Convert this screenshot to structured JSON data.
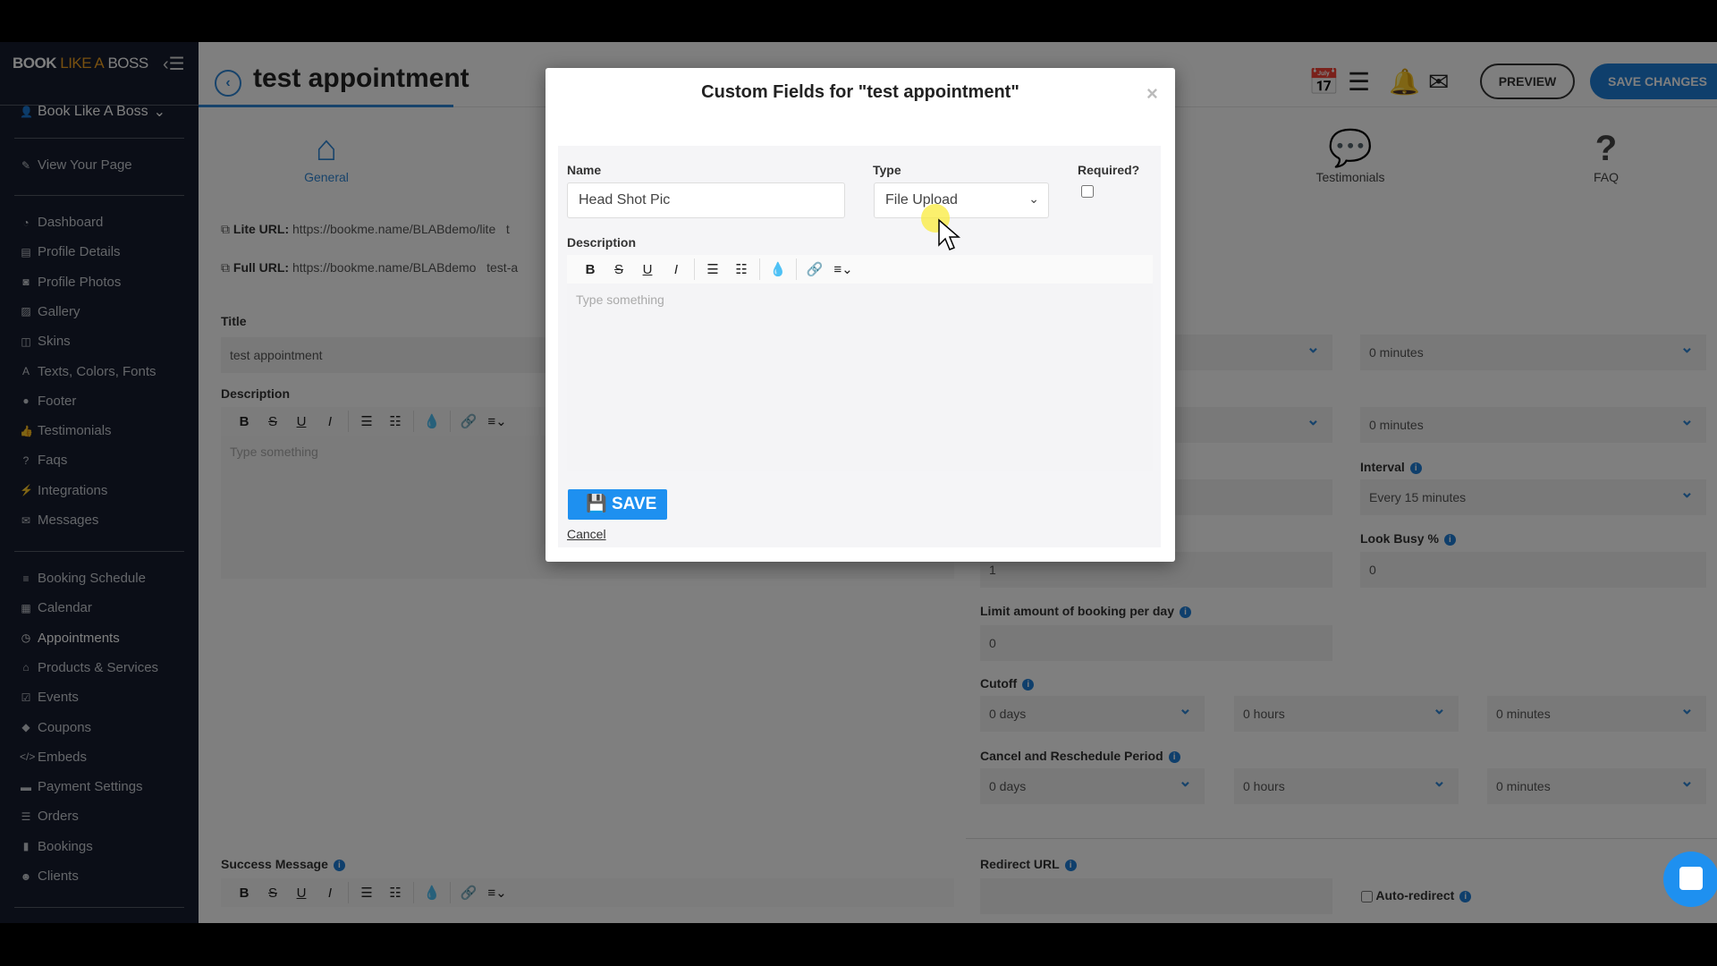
{
  "sidebar": {
    "logo": {
      "part1": "BOOK",
      "part2": "LIKE A",
      "part3": "BOSS"
    },
    "user": "Book Like A Boss",
    "view_page": "View Your Page",
    "items_a": [
      {
        "label": "Dashboard",
        "icon": "dashboard-icon"
      },
      {
        "label": "Profile Details",
        "icon": "id-card-icon"
      },
      {
        "label": "Profile Photos",
        "icon": "camera-icon"
      },
      {
        "label": "Gallery",
        "icon": "image-icon"
      },
      {
        "label": "Skins",
        "icon": "columns-icon"
      },
      {
        "label": "Texts, Colors, Fonts",
        "icon": "font-icon"
      },
      {
        "label": "Footer",
        "icon": "tint-icon"
      },
      {
        "label": "Testimonials",
        "icon": "thumbs-up-icon"
      },
      {
        "label": "Faqs",
        "icon": "question-icon"
      },
      {
        "label": "Integrations",
        "icon": "plug-icon"
      },
      {
        "label": "Messages",
        "icon": "envelope-icon"
      }
    ],
    "items_b": [
      {
        "label": "Booking Schedule",
        "icon": "sliders-icon"
      },
      {
        "label": "Calendar",
        "icon": "calendar-icon"
      },
      {
        "label": "Appointments",
        "icon": "clock-icon",
        "active": true
      },
      {
        "label": "Products & Services",
        "icon": "basket-icon"
      },
      {
        "label": "Events",
        "icon": "calendar-check-icon"
      },
      {
        "label": "Coupons",
        "icon": "tags-icon"
      },
      {
        "label": "Embeds",
        "icon": "code-icon"
      },
      {
        "label": "Payment Settings",
        "icon": "money-icon"
      },
      {
        "label": "Orders",
        "icon": "list-icon"
      },
      {
        "label": "Bookings",
        "icon": "clipboard-icon"
      },
      {
        "label": "Clients",
        "icon": "users-icon"
      }
    ]
  },
  "header": {
    "title": "test appointment",
    "preview": "PREVIEW",
    "save_changes": "SAVE CHANGES"
  },
  "tabs": [
    {
      "label": "General",
      "icon": "home-icon",
      "active": true
    },
    {
      "label": "Testimonials",
      "icon": "comments-icon"
    },
    {
      "label": "FAQ",
      "icon": "question-icon"
    }
  ],
  "urls": {
    "lite_label": "Lite URL:",
    "lite": "https://bookme.name/BLABdemo/lite",
    "lite_extra": "t",
    "full_label": "Full URL:",
    "full": "https://bookme.name/BLABdemo",
    "full_extra": "test-a"
  },
  "form": {
    "title_label": "Title",
    "title_value": "test appointment",
    "description_label": "Description",
    "editor_placeholder": "Type something",
    "success_label": "Success Message",
    "row1_b": "0 minutes",
    "row2_b": "0 minutes",
    "interval_label": "Interval",
    "interval_value": "Every 15 minutes",
    "look_busy_label": "Look Busy %",
    "look_busy_value": "0",
    "col_a_value": "1",
    "limit_label": "Limit amount of booking per day",
    "limit_value": "0",
    "cutoff_label": "Cutoff",
    "cutoff": [
      "0 days",
      "0 hours",
      "0 minutes"
    ],
    "cancel_label": "Cancel and Reschedule Period",
    "cancel": [
      "0 days",
      "0 hours",
      "0 minutes"
    ],
    "redirect_label": "Redirect URL",
    "auto_redirect": "Auto-redirect"
  },
  "modal": {
    "title": "Custom Fields for \"test appointment\"",
    "close": "×",
    "name_label": "Name",
    "name_value": "Head Shot Pic",
    "type_label": "Type",
    "type_value": "File Upload",
    "required_label": "Required?",
    "required": false,
    "description_label": "Description",
    "placeholder": "Type something",
    "save": "SAVE",
    "cancel": "Cancel"
  },
  "colors": {
    "accent": "#1e7fd8",
    "sidebar": "#161d2f",
    "save_button": "#1e90f0"
  }
}
